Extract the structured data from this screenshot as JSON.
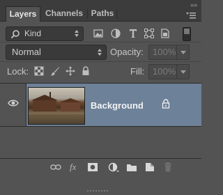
{
  "tabs": [
    {
      "label": "Layers",
      "active": true
    },
    {
      "label": "Channels",
      "active": false
    },
    {
      "label": "Paths",
      "active": false
    }
  ],
  "window": {
    "collapse_glyph": "»»",
    "menu_icon": "panel-menu-icon"
  },
  "filter": {
    "kind_label": "Kind",
    "icons": [
      "pixel-layer-filter-icon",
      "adjustment-layer-filter-icon",
      "type-layer-filter-icon",
      "shape-layer-filter-icon",
      "smart-object-filter-icon"
    ]
  },
  "blend": {
    "mode": "Normal"
  },
  "opacity": {
    "label": "Opacity:",
    "value": "100%"
  },
  "lock": {
    "label": "Lock:",
    "icons": [
      "lock-transparent-pixels-icon",
      "lock-image-pixels-icon",
      "lock-position-icon",
      "lock-all-icon"
    ]
  },
  "fill": {
    "label": "Fill:",
    "value": "100%"
  },
  "layers": [
    {
      "name": "Background",
      "visible": true,
      "locked": true,
      "selected": true
    }
  ],
  "bottom_toolbar": {
    "fx_label": "fx",
    "icons": [
      "link-layers-icon",
      "layer-style-icon",
      "layer-mask-icon",
      "adjustment-layer-icon",
      "new-group-icon",
      "new-layer-icon",
      "delete-layer-icon"
    ]
  },
  "colors": {
    "panel": "#535353",
    "selected_row": "#6d8198",
    "tabbar": "#3c3c3c"
  }
}
